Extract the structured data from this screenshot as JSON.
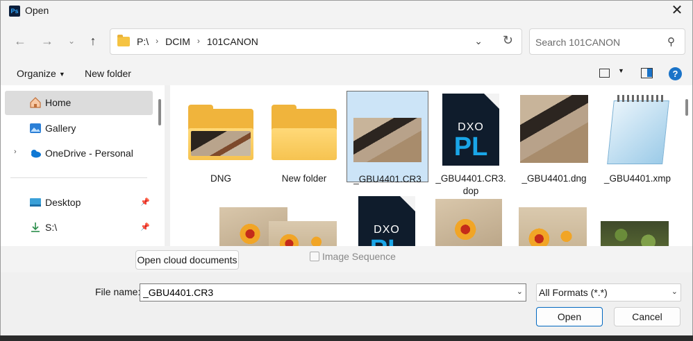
{
  "window": {
    "title": "Open",
    "app_icon": "Ps"
  },
  "nav": {
    "back_icon": "back-arrow-icon",
    "forward_icon": "forward-arrow-icon",
    "recent_icon": "chevron-down-icon",
    "up_icon": "up-arrow-icon",
    "breadcrumbs": [
      "P:\\",
      "DCIM",
      "101CANON"
    ]
  },
  "search": {
    "placeholder": "Search 101CANON"
  },
  "toolbar": {
    "organize": "Organize",
    "new_folder": "New folder"
  },
  "sidebar": {
    "items": [
      {
        "label": "Home",
        "icon": "home-icon"
      },
      {
        "label": "Gallery",
        "icon": "gallery-icon"
      },
      {
        "label": "OneDrive - Personal",
        "icon": "cloud-icon"
      },
      {
        "label": "Desktop",
        "icon": "desktop-icon"
      },
      {
        "label": "S:\\",
        "icon": "download-icon"
      }
    ]
  },
  "files": [
    {
      "name": "DNG",
      "type": "folder"
    },
    {
      "name": "New folder",
      "type": "folder"
    },
    {
      "name": "_GBU4401.CR3",
      "type": "image",
      "selected": true
    },
    {
      "name": "_GBU4401.CR3.dop",
      "type": "dxo"
    },
    {
      "name": "_GBU4401.dng",
      "type": "image"
    },
    {
      "name": "_GBU4401.xmp",
      "type": "notepad"
    }
  ],
  "dxo_logo": {
    "text": "DXO",
    "mark": "PL"
  },
  "bottom": {
    "open_cloud": "Open cloud documents",
    "image_sequence": "Image Sequence",
    "file_name_label": "File name:",
    "file_name_value": "_GBU4401.CR3",
    "format": "All Formats (*.*)",
    "open_button": "Open",
    "cancel_button": "Cancel"
  }
}
